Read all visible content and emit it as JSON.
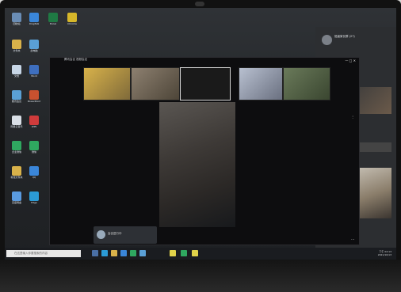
{
  "desktop": {
    "icons": [
      {
        "label": "回收站",
        "color": "#6a8db5"
      },
      {
        "label": "DingTalk",
        "color": "#3a86d9"
      },
      {
        "label": "Excel",
        "color": "#1f7a44"
      },
      {
        "label": "Chrome",
        "color": "#d6b72a"
      },
      {
        "label": "文件夹",
        "color": "#d9b24a"
      },
      {
        "label": "此电脑",
        "color": "#5aa0d6"
      },
      {
        "label": "文档",
        "color": "#c7d6e6"
      },
      {
        "label": "Word",
        "color": "#3e6fbf"
      },
      {
        "label": "腾讯会议",
        "color": "#5aa0d6"
      },
      {
        "label": "PowerPoint",
        "color": "#c8512f"
      },
      {
        "label": "网易云音乐",
        "color": "#d9dfe6"
      },
      {
        "label": "WPS",
        "color": "#cf3b3b"
      },
      {
        "label": "企业微信",
        "color": "#2fa860"
      },
      {
        "label": "微信",
        "color": "#2fa860"
      },
      {
        "label": "新建文件夹",
        "color": "#d9b24a"
      },
      {
        "label": "QQ",
        "color": "#3a86d9"
      },
      {
        "label": "百度网盘",
        "color": "#5a9be0"
      },
      {
        "label": "Edge",
        "color": "#2b9bd6"
      }
    ]
  },
  "meeting": {
    "title": "腾讯会议 视频会议",
    "participants": [
      {
        "name": "",
        "tone": "#c8a24a"
      },
      {
        "name": "",
        "tone": "#8a7a6a"
      },
      {
        "name": "",
        "tone": "#222"
      },
      {
        "name": "",
        "tone": "#a8b0c0"
      },
      {
        "name": "",
        "tone": "#5a6a4a"
      }
    ],
    "controls": {
      "end": "···"
    }
  },
  "panel": {
    "chat_name": "班级家长群 (27)",
    "messages": [
      "Mina",
      "Mina",
      "Mina",
      "Mina"
    ]
  },
  "notification": {
    "text": "会议进行中"
  },
  "taskbar": {
    "search_placeholder": "在这里输入你要搜索的内容",
    "time": "下午 04:13",
    "date": "2021/10/13"
  }
}
